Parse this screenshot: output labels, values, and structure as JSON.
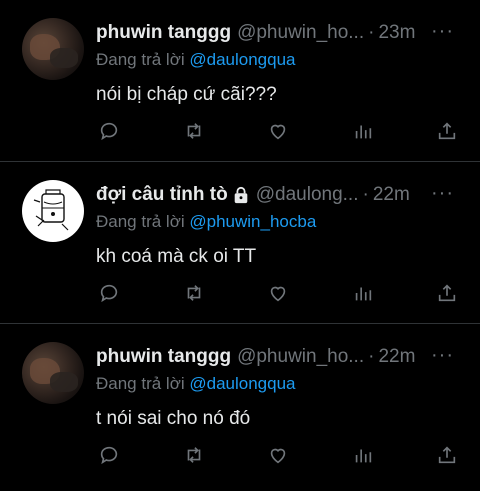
{
  "tweets": [
    {
      "name": "phuwin tanggg",
      "handle": "@phuwin_ho...",
      "time": "23m",
      "reply_prefix": "Đang trả lời",
      "reply_to": "@daulongqua",
      "text": "nói bị cháp cứ cãi???",
      "locked": false,
      "avatar": "photo"
    },
    {
      "name": "đợi câu tỉnh tò",
      "handle": "@daulong...",
      "time": "22m",
      "reply_prefix": "Đang trả lời",
      "reply_to": "@phuwin_hocba",
      "text": "kh coá mà ck oi TT",
      "locked": true,
      "avatar": "sketch"
    },
    {
      "name": "phuwin tanggg",
      "handle": "@phuwin_ho...",
      "time": "22m",
      "reply_prefix": "Đang trả lời",
      "reply_to": "@daulongqua",
      "text": "t nói sai cho nó đó",
      "locked": false,
      "avatar": "photo"
    }
  ],
  "ui": {
    "separator": "·",
    "more_glyph": "···",
    "accent_color": "#1d9bf0",
    "muted_color": "#71767b"
  },
  "icons": [
    "reply-icon",
    "retweet-icon",
    "like-icon",
    "analytics-icon",
    "share-icon",
    "lock-icon",
    "more-icon"
  ]
}
